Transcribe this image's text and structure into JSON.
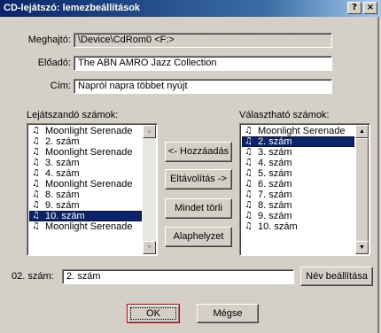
{
  "window": {
    "title": "CD-lejátszó: lemezbeállítások",
    "help_glyph": "?",
    "close_glyph": "×"
  },
  "fields": {
    "drive_label": "Meghajtó:",
    "drive_value": "\\Device\\CdRom0 <F:>",
    "artist_label": "Előadó:",
    "artist_value": "The ABN AMRO Jazz Collection",
    "title_label": "Cím:",
    "title_value": "Napról napra többet nyújt"
  },
  "playlist": {
    "label": "Lejátszandó számok:",
    "items": [
      "Moonlight Serenade",
      "2. szám",
      "Moonlight Serenade",
      "3. szám",
      "4. szám",
      "Moonlight Serenade",
      "8. szám",
      "9. szám",
      "10. szám",
      "Moonlight Serenade"
    ],
    "selected_index": 8
  },
  "available": {
    "label": "Választható számok:",
    "items": [
      "Moonlight Serenade",
      "2. szám",
      "3. szám",
      "4. szám",
      "5. szám",
      "6. szám",
      "7. szám",
      "8. szám",
      "9. szám",
      "10. szám"
    ],
    "selected_index": 1
  },
  "buttons": {
    "add": "<- Hozzáadás",
    "remove": "Eltávolítás ->",
    "clear": "Mindet törli",
    "reset": "Alaphelyzet",
    "set_name": "Név beállítása",
    "ok": "OK",
    "cancel": "Mégse"
  },
  "track": {
    "label": "02. szám:",
    "value": "2. szám"
  },
  "icons": {
    "note": "♫",
    "scroll_up": "▲",
    "scroll_down": "▼"
  }
}
